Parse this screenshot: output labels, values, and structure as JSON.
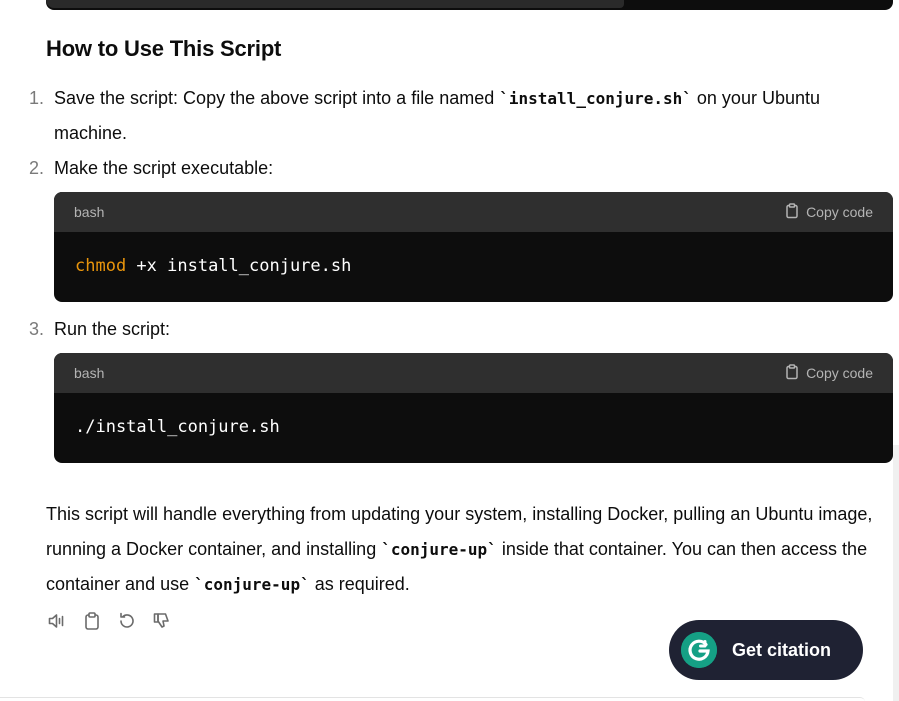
{
  "section": {
    "heading": "How to Use This Script"
  },
  "steps": [
    {
      "number": "1.",
      "text_before": "Save the script: Copy the above script into a file named ",
      "code": "`install_conjure.sh`",
      "text_after": " on your Ubuntu machine."
    },
    {
      "number": "2.",
      "text": "Make the script executable:",
      "code_block": {
        "language": "bash",
        "copy_label": "Copy code",
        "keyword": "chmod",
        "rest": " +x install_conjure.sh"
      }
    },
    {
      "number": "3.",
      "text": "Run the script:",
      "code_block": {
        "language": "bash",
        "copy_label": "Copy code",
        "code": "./install_conjure.sh"
      }
    }
  ],
  "summary": {
    "part1": "This script will handle everything from updating your system, installing Docker, pulling an Ubuntu image, running a Docker container, and installing ",
    "code1": "`conjure-up`",
    "part2": " inside that container. You can then access the container and use ",
    "code2": "`conjure-up`",
    "part3": " as required."
  },
  "actions": [
    "read-aloud-icon",
    "copy-icon",
    "regenerate-icon",
    "thumbs-down-icon"
  ],
  "citation_button": {
    "label": "Get citation",
    "logo_color": "#15a085",
    "bg_color": "#1f2233"
  },
  "colors": {
    "code_bg": "#0d0d0d",
    "code_header_bg": "#2f2f2f",
    "keyword": "#e9950c"
  }
}
